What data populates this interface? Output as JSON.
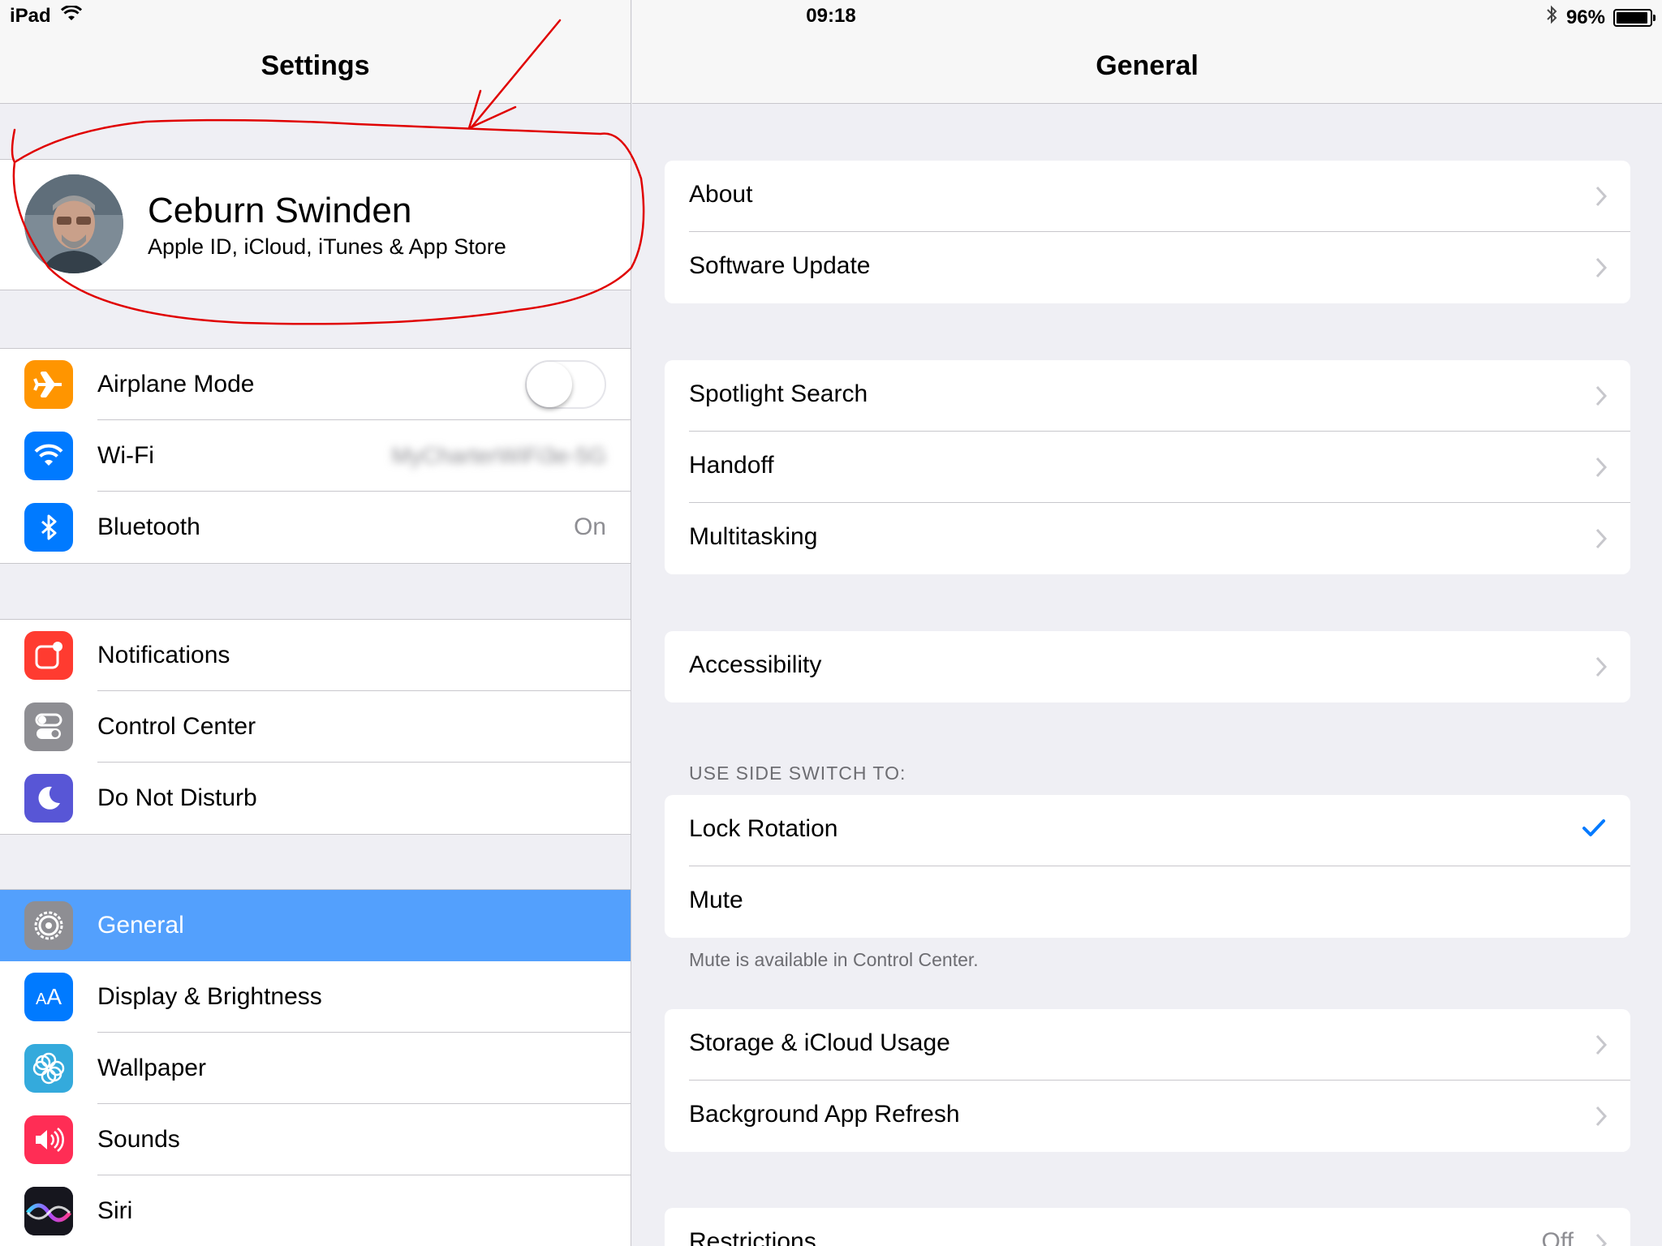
{
  "status_bar": {
    "device": "iPad",
    "time": "09:18",
    "battery_percent": "96%",
    "battery_level": 0.96,
    "wifi_icon": "wifi-icon",
    "bluetooth_icon": "bluetooth-icon"
  },
  "master": {
    "title": "Settings",
    "profile": {
      "name": "Ceburn Swinden",
      "subtitle": "Apple ID, iCloud, iTunes & App Store"
    },
    "groups": [
      [
        {
          "label": "Airplane Mode",
          "icon": "airplane-icon",
          "color": "#ff9500",
          "accessory": "toggle",
          "toggle_on": false
        },
        {
          "label": "Wi-Fi",
          "icon": "wifi-icon",
          "color": "#007aff",
          "value": "MyCharterWiFi3e-5G"
        },
        {
          "label": "Bluetooth",
          "icon": "bluetooth-icon",
          "color": "#007aff",
          "value": "On"
        }
      ],
      [
        {
          "label": "Notifications",
          "icon": "notifications-icon",
          "color": "#ff3b30"
        },
        {
          "label": "Control Center",
          "icon": "control-center-icon",
          "color": "#8e8e93"
        },
        {
          "label": "Do Not Disturb",
          "icon": "moon-icon",
          "color": "#5856d6"
        }
      ],
      [
        {
          "label": "General",
          "icon": "gear-icon",
          "color": "#8e8e93",
          "selected": true
        },
        {
          "label": "Display & Brightness",
          "icon": "display-icon",
          "color": "#007aff"
        },
        {
          "label": "Wallpaper",
          "icon": "wallpaper-icon",
          "color": "#34aadc"
        },
        {
          "label": "Sounds",
          "icon": "sounds-icon",
          "color": "#ff2d55"
        },
        {
          "label": "Siri",
          "icon": "siri-icon",
          "color": "#000000"
        }
      ]
    ]
  },
  "detail": {
    "title": "General",
    "group1": [
      "About",
      "Software Update"
    ],
    "group2": [
      "Spotlight Search",
      "Handoff",
      "Multitasking"
    ],
    "group3": [
      "Accessibility"
    ],
    "side_switch_header": "USE SIDE SWITCH TO:",
    "side_switch": {
      "lock_rotation": "Lock Rotation",
      "mute": "Mute",
      "selected": "Lock Rotation"
    },
    "side_switch_footer": "Mute is available in Control Center.",
    "group5": [
      "Storage & iCloud Usage",
      "Background App Refresh"
    ],
    "restrictions": {
      "label": "Restrictions",
      "value": "Off"
    }
  },
  "colors": {
    "accent": "#007aff",
    "selection": "#53a0fd",
    "annotation": "#e00000"
  }
}
